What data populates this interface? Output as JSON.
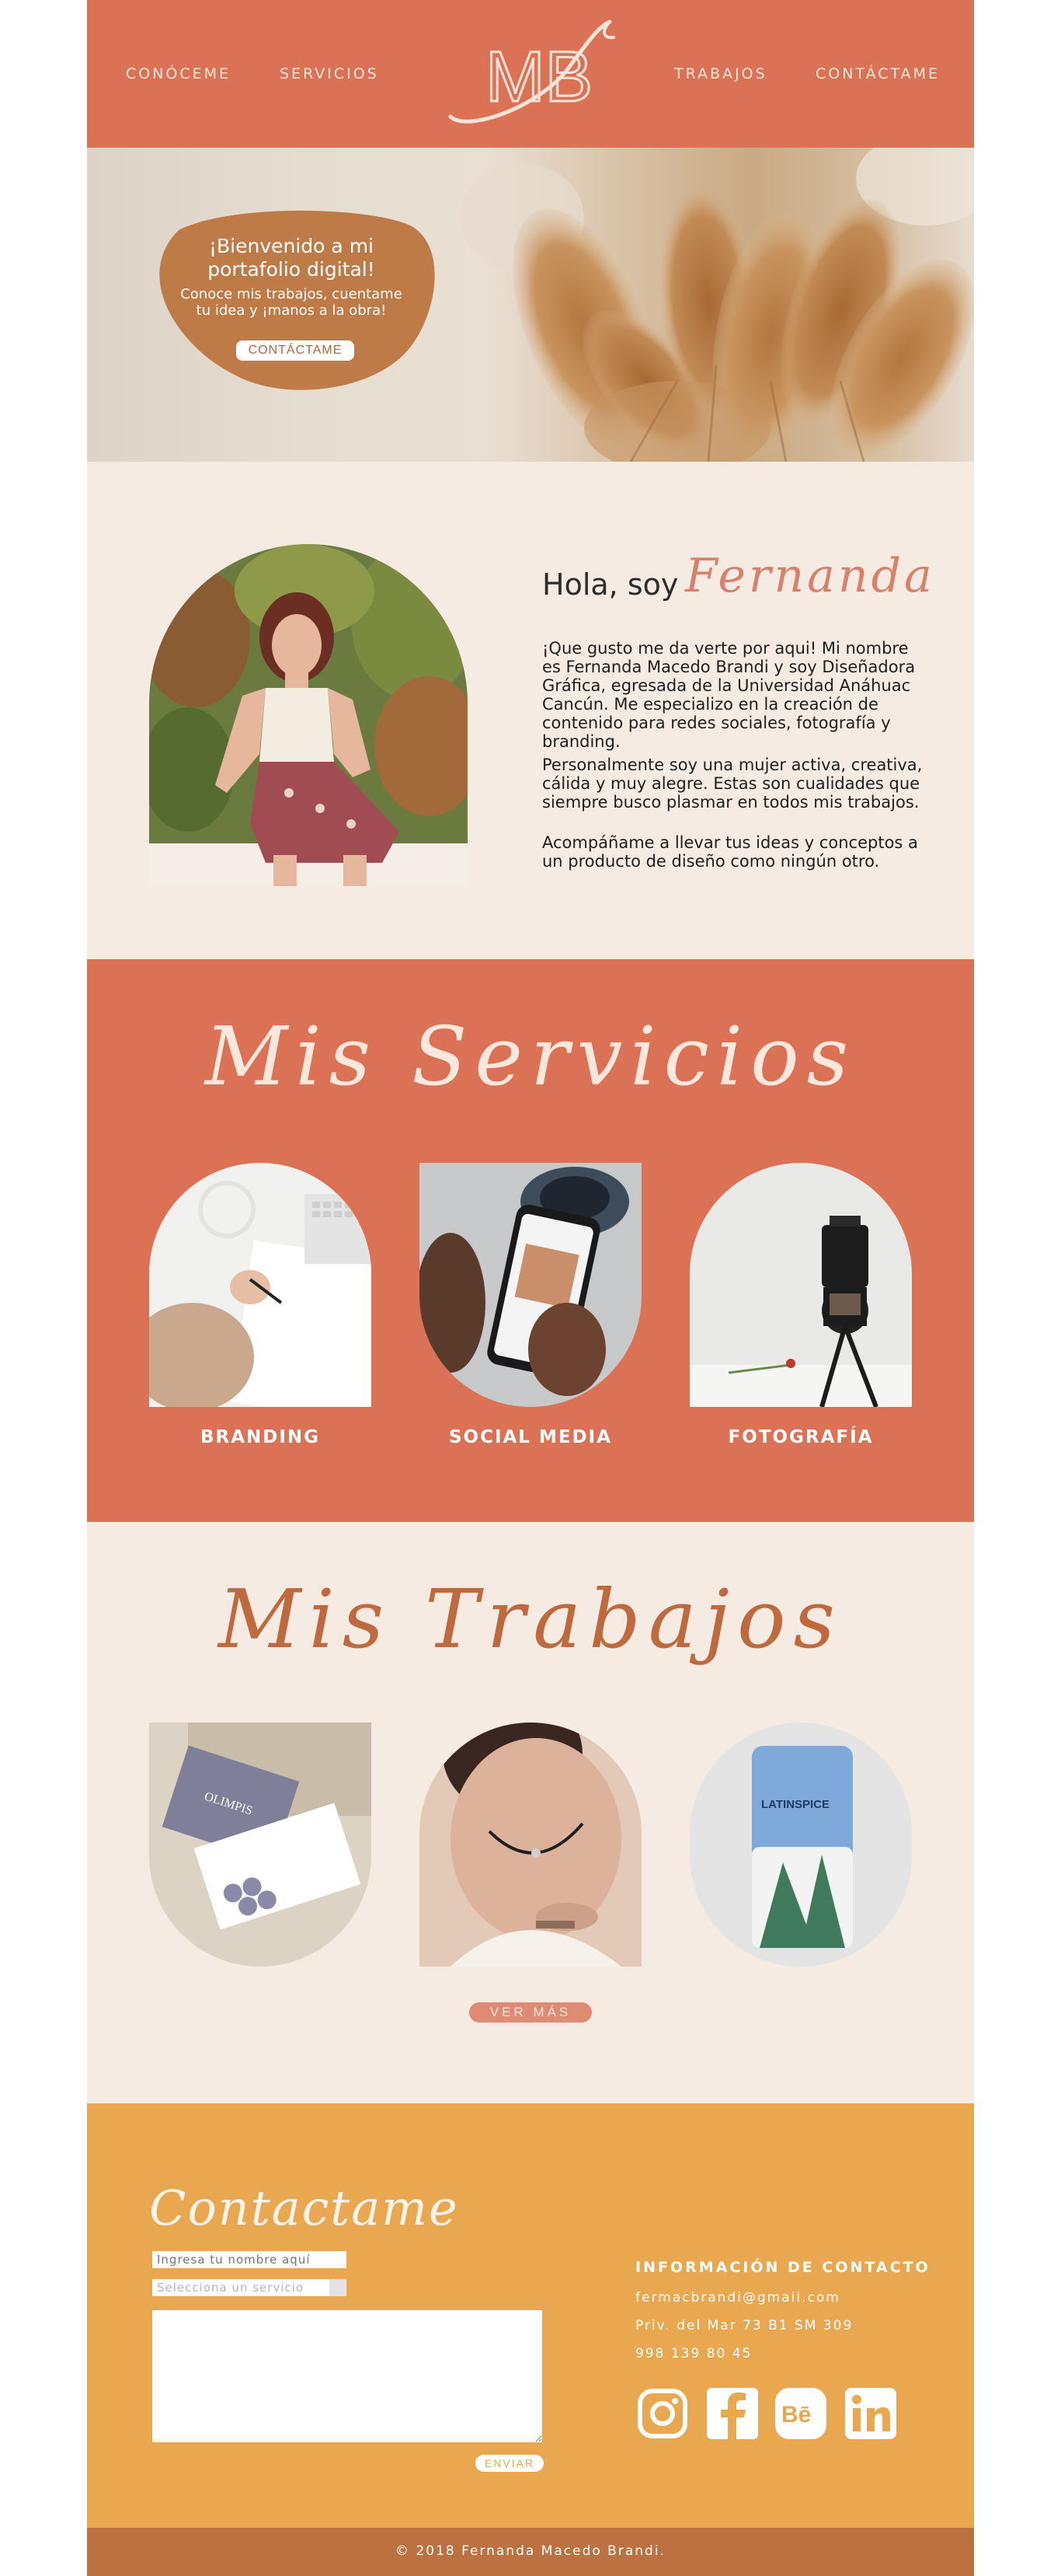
{
  "colors": {
    "header": "#dc7255",
    "cream": "#f5ebe3",
    "mustard": "#e9a850",
    "footer": "#bd7141",
    "accent_script": "#d6826a",
    "works_script": "#bf6a3e"
  },
  "nav": {
    "about": "CONÓCEME",
    "services": "SERVICIOS",
    "works": "TRABAJOS",
    "contact": "CONTÁCTAME",
    "logo_text": "MB"
  },
  "hero": {
    "title": "¡Bienvenido a mi portafolio digital!",
    "subtitle": "Conoce mis trabajos, cuentame tu idea y ¡manos a la obra!",
    "button": "CONTÁCTAME"
  },
  "about": {
    "greeting": "Hola, soy",
    "name": "Fernanda",
    "p1": "¡Que gusto me da verte por aqui! Mi nombre es Fernanda Macedo Brandi y soy Diseñadora Gráfica, egresada de la Universidad Anáhuac Cancún. Me especializo en la creación de contenido para redes sociales, fotografía y branding.",
    "p2": "Personalmente soy una mujer activa, creativa, cálida y muy alegre. Estas son cualidades que siempre busco plasmar en todos mis trabajos.",
    "p3": "Acompáñame a llevar tus ideas y conceptos a un producto de diseño como ningún otro."
  },
  "services": {
    "title": "Mis Servicios",
    "items": [
      {
        "label": "BRANDING",
        "icon": "branding-photo"
      },
      {
        "label": "SOCIAL MEDIA",
        "icon": "social-media-photo"
      },
      {
        "label": "FOTOGRAFÍA",
        "icon": "photography-photo"
      }
    ]
  },
  "works": {
    "title": "Mis Trabajos",
    "items": [
      {
        "name": "business-cards",
        "brand": "OLIMPIS"
      },
      {
        "name": "jewelry",
        "brand": ""
      },
      {
        "name": "tea-package",
        "brand": "LATINSPICE"
      }
    ],
    "more_button": "VER MÁS"
  },
  "contact": {
    "title": "Contactame",
    "name_placeholder": "Ingresa tu nombre aquí",
    "service_placeholder": "Selecciona un servicio",
    "send_button": "ENVIAR",
    "info_title": "INFORMACIÓN DE CONTACTO",
    "email": "fermacbrandi@gmail.com",
    "address": "Priv. del Mar 73 B1 SM 309",
    "phone": "998 139 80 45",
    "socials": [
      "instagram-icon",
      "facebook-icon",
      "behance-icon",
      "linkedin-icon"
    ]
  },
  "footer": {
    "copyright": "© 2018 Fernanda Macedo Brandi."
  }
}
